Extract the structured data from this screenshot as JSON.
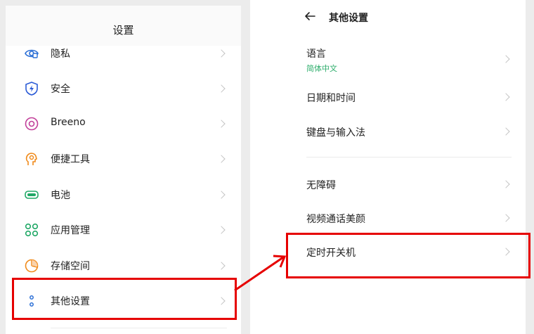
{
  "left_panel": {
    "title": "设置",
    "items": [
      {
        "label": "隐私",
        "icon": "privacy-eye-icon",
        "color": "#2b6fd6"
      },
      {
        "label": "安全",
        "icon": "security-shield-icon",
        "color": "#2b5bd6"
      },
      {
        "label": "Breeno",
        "icon": "breeno-icon",
        "color": "#c2409a"
      },
      {
        "label": "便捷工具",
        "icon": "convenience-tools-icon",
        "color": "#f08b1c"
      },
      {
        "label": "电池",
        "icon": "battery-icon",
        "color": "#20a866"
      },
      {
        "label": "应用管理",
        "icon": "app-management-icon",
        "color": "#20a866"
      },
      {
        "label": "存储空间",
        "icon": "storage-pie-icon",
        "color": "#f08b1c"
      },
      {
        "label": "其他设置",
        "icon": "more-settings-icon",
        "color": "#2b6fd6"
      }
    ]
  },
  "right_panel": {
    "title": "其他设置",
    "items": [
      {
        "label": "语言",
        "sub": "简体中文"
      },
      {
        "label": "日期和时间"
      },
      {
        "label": "键盘与输入法"
      },
      {
        "label": "无障碍"
      },
      {
        "label": "视频通话美颜"
      },
      {
        "label": "定时开关机"
      }
    ]
  },
  "colors": {
    "highlight": "#e60000",
    "accent_green": "#2eae6c"
  }
}
